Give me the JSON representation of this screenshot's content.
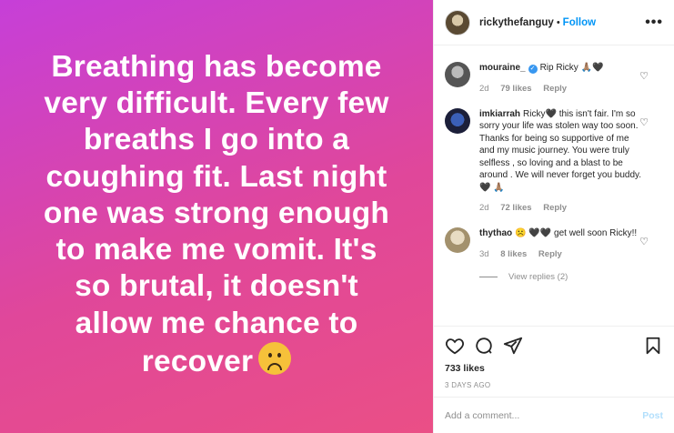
{
  "post": {
    "lines": [
      "Breathing has become",
      "very difficult. Every few",
      "breaths I go into a",
      "coughing fit. Last night",
      "one was strong enough",
      "to make me vomit. It's",
      "so brutal, it doesn't",
      "allow me chance to",
      "recover"
    ],
    "emoji": "frowning-face-icon"
  },
  "header": {
    "username": "rickythefanguy",
    "separator": "•",
    "follow": "Follow",
    "more": "•••"
  },
  "comments": [
    {
      "user": "mouraine_",
      "verified": true,
      "text": "Rip Ricky 🙏🏽🖤",
      "time": "2d",
      "likes": "79 likes",
      "reply": "Reply"
    },
    {
      "user": "imkiarrah",
      "verified": false,
      "text": "Ricky🖤 this isn't fair. I'm so sorry your life was stolen way too soon. Thanks for being so supportive of me and my music journey. You were truly selfless , so loving and a blast to be around . We will never forget you buddy. 🖤 🙏🏽",
      "time": "2d",
      "likes": "72 likes",
      "reply": "Reply"
    },
    {
      "user": "thythao",
      "verified": false,
      "text": "☹️ 🖤🖤 get well soon Ricky!!",
      "time": "3d",
      "likes": "8 likes",
      "reply": "Reply"
    }
  ],
  "view_replies": "View replies (2)",
  "stats": {
    "likes": "733 likes",
    "time_ago": "3 DAYS AGO"
  },
  "add_comment": {
    "placeholder": "Add a comment...",
    "post": "Post"
  },
  "colors": {
    "follow": "#0095f6",
    "gradient_start": "#c63fd8",
    "gradient_end": "#ea4f86"
  }
}
